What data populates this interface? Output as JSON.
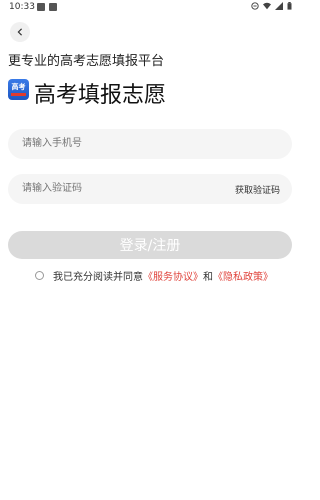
{
  "status_bar": {
    "time": "10:33"
  },
  "header": {
    "subtitle": "更专业的高考志愿填报平台",
    "title": "高考填报志愿"
  },
  "logo": {
    "text": "高考"
  },
  "form": {
    "phone_placeholder": "请输入手机号",
    "code_placeholder": "请输入验证码",
    "get_code_label": "获取验证码",
    "submit_label": "登录/注册"
  },
  "agreement": {
    "prefix": "我已充分阅读并同意",
    "service_link": "《服务协议》",
    "and": "和",
    "privacy_link": "《隐私政策》"
  }
}
